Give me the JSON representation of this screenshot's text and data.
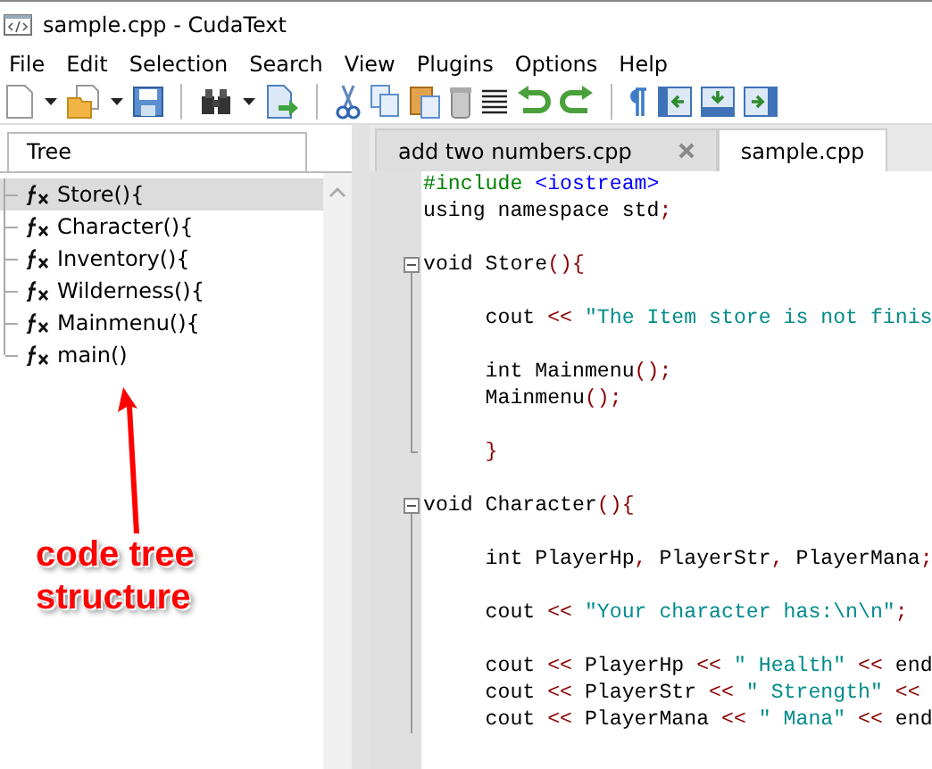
{
  "window": {
    "title": "sample.cpp - CudaText"
  },
  "menu": [
    "File",
    "Edit",
    "Selection",
    "Search",
    "View",
    "Plugins",
    "Options",
    "Help"
  ],
  "toolbar": [
    {
      "kind": "new"
    },
    {
      "kind": "dropdown"
    },
    {
      "kind": "open"
    },
    {
      "kind": "dropdown"
    },
    {
      "kind": "save"
    },
    {
      "kind": "separator"
    },
    {
      "kind": "find"
    },
    {
      "kind": "dropdown"
    },
    {
      "kind": "goto"
    },
    {
      "kind": "separator"
    },
    {
      "kind": "cut"
    },
    {
      "kind": "copy"
    },
    {
      "kind": "paste"
    },
    {
      "kind": "delete"
    },
    {
      "kind": "lines"
    },
    {
      "kind": "undo"
    },
    {
      "kind": "redo"
    },
    {
      "kind": "separator"
    },
    {
      "kind": "pilcrow"
    },
    {
      "kind": "panel-left"
    },
    {
      "kind": "panel-bottom"
    },
    {
      "kind": "panel-right"
    }
  ],
  "side_tabs": [
    {
      "label": "Tree",
      "selected": true
    }
  ],
  "tree": {
    "items": [
      {
        "label": "Store(){",
        "selected": true
      },
      {
        "label": "Character(){",
        "selected": false
      },
      {
        "label": "Inventory(){",
        "selected": false
      },
      {
        "label": "Wilderness(){",
        "selected": false
      },
      {
        "label": "Mainmenu(){",
        "selected": false
      },
      {
        "label": "main()",
        "selected": false
      }
    ]
  },
  "annotation": {
    "text": "code tree structure"
  },
  "editor_tabs": [
    {
      "label": "add two numbers.cpp",
      "selected": false,
      "closable": true
    },
    {
      "label": "sample.cpp",
      "selected": true,
      "closable": false
    }
  ],
  "code_blocks": [
    {
      "foldable": false,
      "groups": [
        [
          {
            "tokens": [
              {
                "kind": "directive",
                "text": "#include "
              },
              {
                "kind": "header",
                "text": "<iostream>"
              }
            ]
          },
          {
            "tokens": [
              {
                "kind": "plain",
                "text": "using namespace std"
              },
              {
                "kind": "op",
                "text": ";"
              }
            ]
          }
        ]
      ]
    },
    {
      "foldable": true,
      "end_shown": true,
      "groups": [
        [
          {
            "tokens": [
              {
                "kind": "plain",
                "text": "void Store"
              },
              {
                "kind": "op",
                "text": "(){"
              }
            ]
          }
        ],
        [
          {
            "tokens": [
              {
                "kind": "plain",
                "text": "     cout "
              },
              {
                "kind": "op",
                "text": "<<"
              },
              {
                "kind": "string",
                "text": " \"The Item store is not finis"
              }
            ]
          }
        ],
        [
          {
            "tokens": [
              {
                "kind": "plain",
                "text": "     int Mainmenu"
              },
              {
                "kind": "op",
                "text": "();"
              }
            ]
          },
          {
            "tokens": [
              {
                "kind": "plain",
                "text": "     Mainmenu"
              },
              {
                "kind": "op",
                "text": "();"
              }
            ]
          }
        ],
        [
          {
            "tokens": [
              {
                "kind": "op",
                "text": "     }"
              }
            ]
          }
        ]
      ]
    },
    {
      "foldable": true,
      "end_shown": false,
      "groups": [
        [
          {
            "tokens": [
              {
                "kind": "plain",
                "text": "void Character"
              },
              {
                "kind": "op",
                "text": "(){"
              }
            ]
          }
        ],
        [
          {
            "tokens": [
              {
                "kind": "plain",
                "text": "     int PlayerHp"
              },
              {
                "kind": "op",
                "text": ","
              },
              {
                "kind": "plain",
                "text": " PlayerStr"
              },
              {
                "kind": "op",
                "text": ","
              },
              {
                "kind": "plain",
                "text": " PlayerMana"
              },
              {
                "kind": "op",
                "text": ";"
              }
            ]
          }
        ],
        [
          {
            "tokens": [
              {
                "kind": "plain",
                "text": "     cout "
              },
              {
                "kind": "op",
                "text": "<<"
              },
              {
                "kind": "string",
                "text": " \"Your character has:\\n\\n\""
              },
              {
                "kind": "op",
                "text": ";"
              }
            ]
          }
        ],
        [
          {
            "tokens": [
              {
                "kind": "plain",
                "text": "     cout "
              },
              {
                "kind": "op",
                "text": "<<"
              },
              {
                "kind": "plain",
                "text": " PlayerHp "
              },
              {
                "kind": "op",
                "text": "<<"
              },
              {
                "kind": "string",
                "text": " \" Health\" "
              },
              {
                "kind": "op",
                "text": "<<"
              },
              {
                "kind": "plain",
                "text": " end"
              }
            ]
          },
          {
            "tokens": [
              {
                "kind": "plain",
                "text": "     cout "
              },
              {
                "kind": "op",
                "text": "<<"
              },
              {
                "kind": "plain",
                "text": " PlayerStr "
              },
              {
                "kind": "op",
                "text": "<<"
              },
              {
                "kind": "string",
                "text": " \" Strength\" "
              },
              {
                "kind": "op",
                "text": "<<"
              }
            ]
          },
          {
            "tokens": [
              {
                "kind": "plain",
                "text": "     cout "
              },
              {
                "kind": "op",
                "text": "<<"
              },
              {
                "kind": "plain",
                "text": " PlayerMana "
              },
              {
                "kind": "op",
                "text": "<<"
              },
              {
                "kind": "string",
                "text": " \" Mana\" "
              },
              {
                "kind": "op",
                "text": "<<"
              },
              {
                "kind": "plain",
                "text": " end"
              }
            ]
          }
        ]
      ]
    }
  ]
}
